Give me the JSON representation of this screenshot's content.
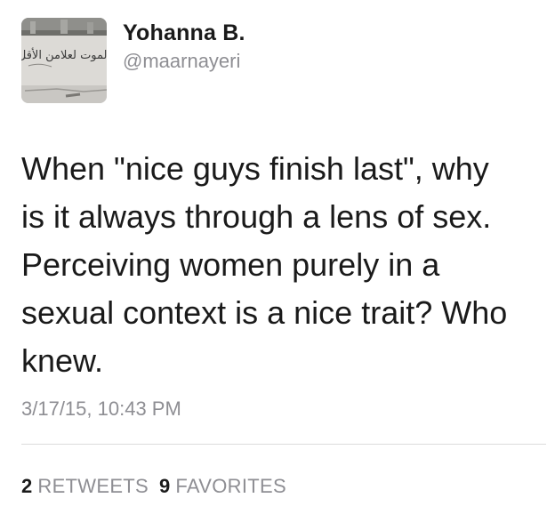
{
  "user": {
    "display_name": "Yohanna B.",
    "handle": "@maarnayeri",
    "avatar_graffiti_text": "الموت لعلامن الأقل"
  },
  "tweet": {
    "text": "When \"nice guys finish last\", why\nis it always through a lens of sex.\nPerceiving women purely in a\nsexual context is a nice trait? Who\nknew.",
    "timestamp": "3/17/15, 10:43 PM"
  },
  "stats": {
    "retweets_count": "2",
    "retweets_label": "RETWEETS",
    "favorites_count": "9",
    "favorites_label": "FAVORITES"
  }
}
